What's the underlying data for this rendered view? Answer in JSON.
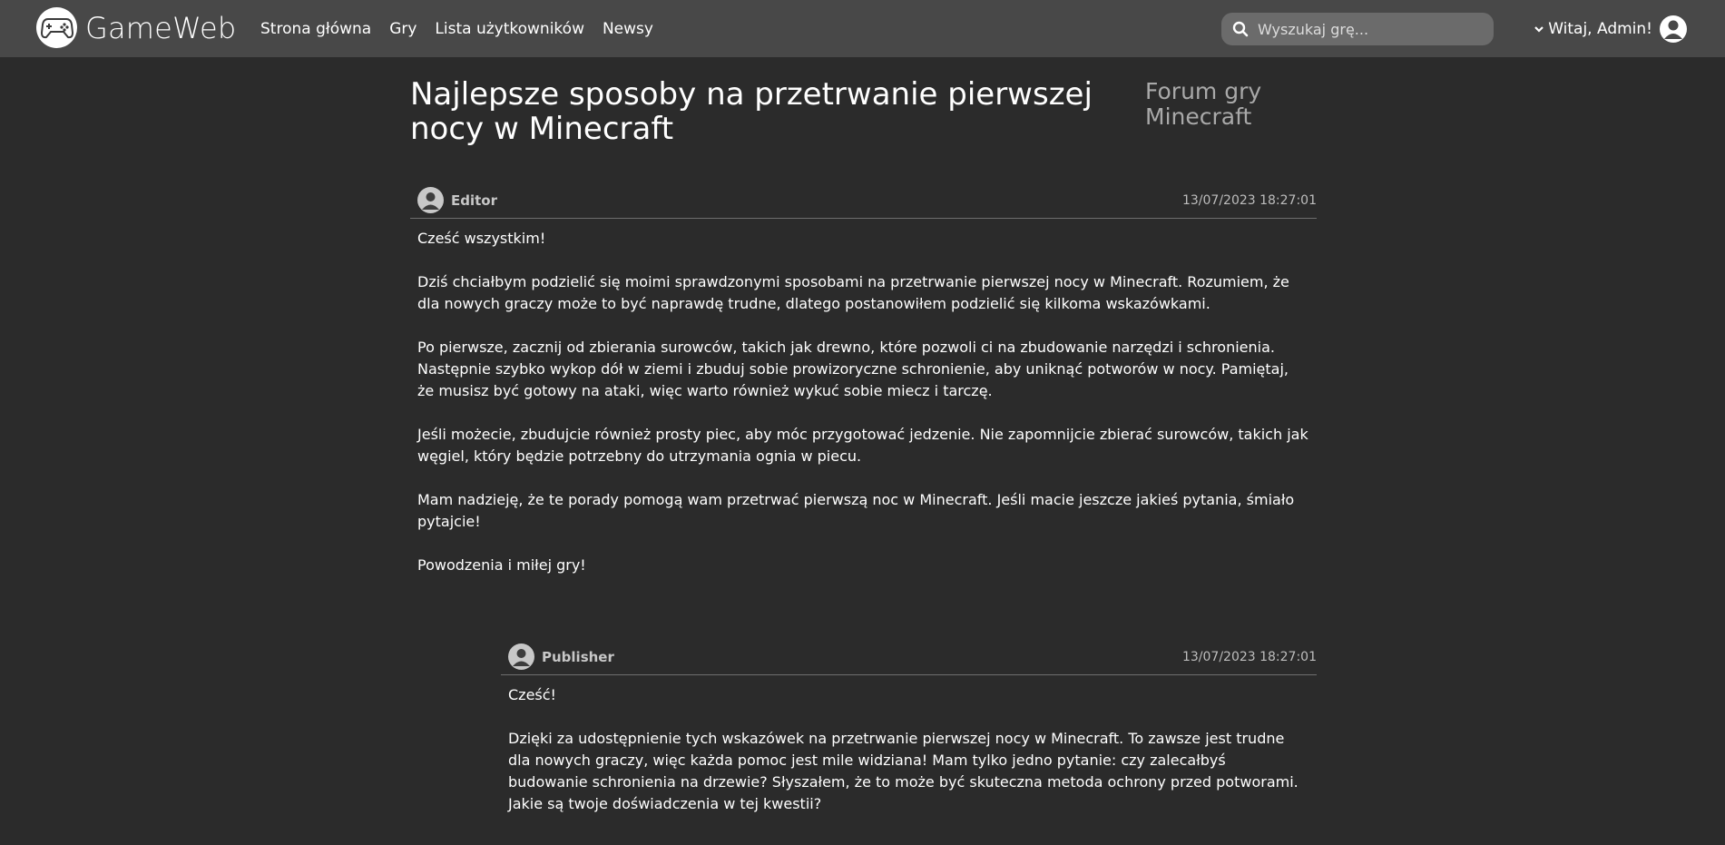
{
  "header": {
    "logo_text": "GameWeb",
    "nav": [
      {
        "label": "Strona główna"
      },
      {
        "label": "Gry"
      },
      {
        "label": "Lista użytkowników"
      },
      {
        "label": "Newsy"
      }
    ],
    "search": {
      "placeholder": "Wyszukaj grę..."
    },
    "user_greeting": "Witaj, Admin!"
  },
  "page": {
    "title": "Najlepsze sposoby na przetrwanie pierwszej nocy w Minecraft",
    "forum_name": "Forum gry Minecraft"
  },
  "posts": [
    {
      "author": "Editor",
      "date": "13/07/2023 18:27:01",
      "paragraphs": [
        "Cześć wszystkim!",
        "Dziś chciałbym podzielić się moimi sprawdzonymi sposobami na przetrwanie pierwszej nocy w Minecraft. Rozumiem, że dla nowych graczy może to być naprawdę trudne, dlatego postanowiłem podzielić się kilkoma wskazówkami.",
        "Po pierwsze, zacznij od zbierania surowców, takich jak drewno, które pozwoli ci na zbudowanie narzędzi i schronienia. Następnie szybko wykop dół w ziemi i zbuduj sobie prowizoryczne schronienie, aby uniknąć potworów w nocy. Pamiętaj, że musisz być gotowy na ataki, więc warto również wykuć sobie miecz i tarczę.",
        "Jeśli możecie, zbudujcie również prosty piec, aby móc przygotować jedzenie. Nie zapomnijcie zbierać surowców, takich jak węgiel, który będzie potrzebny do utrzymania ognia w piecu.",
        "Mam nadzieję, że te porady pomogą wam przetrwać pierwszą noc w Minecraft. Jeśli macie jeszcze jakieś pytania, śmiało pytajcie!",
        "Powodzenia i miłej gry!"
      ]
    },
    {
      "author": "Publisher",
      "date": "13/07/2023 18:27:01",
      "paragraphs": [
        "Cześć!",
        "Dzięki za udostępnienie tych wskazówek na przetrwanie pierwszej nocy w Minecraft. To zawsze jest trudne dla nowych graczy, więc każda pomoc jest mile widziana! Mam tylko jedno pytanie: czy zalecałbyś budowanie schronienia na drzewie? Słyszałem, że to może być skuteczna metoda ochrony przed potworami. Jakie są twoje doświadczenia w tej kwestii?"
      ]
    }
  ],
  "colors": {
    "topbar": "#484848",
    "background": "#2b2b2b",
    "search_bg": "#6b6b6b",
    "muted_text": "#a9a9a9"
  },
  "icons": {
    "logo": "gamepad-icon",
    "search": "search-icon",
    "menu": "chevron-down-icon",
    "user": "user-avatar-icon"
  }
}
